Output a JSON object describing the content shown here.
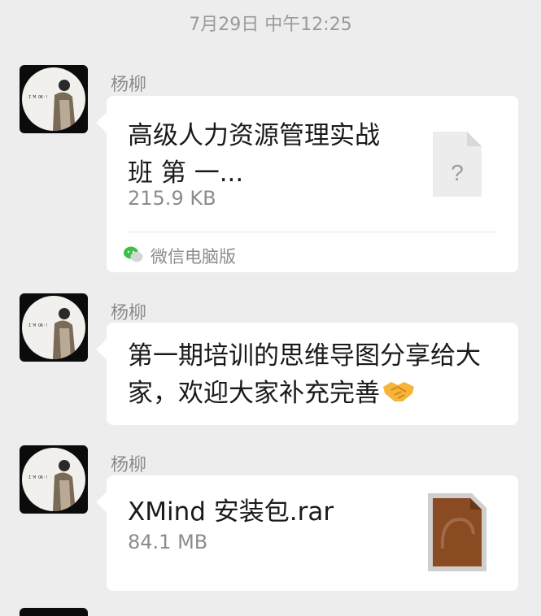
{
  "timestamp": "7月29日 中午12:25",
  "messages": [
    {
      "sender": "杨柳",
      "file_title": "高级人力资源管理实战班 第 一...",
      "file_size": "215.9 KB",
      "source": "微信电脑版",
      "icon": "unknown-file-icon"
    },
    {
      "sender": "杨柳",
      "text": "第一期培训的思维导图分享给大家，欢迎大家补充完善",
      "emoji": "handshake-emoji"
    },
    {
      "sender": "杨柳",
      "file_title": "XMind 安装包.rar",
      "file_size": "84.1 MB",
      "icon": "rar-archive-icon"
    }
  ],
  "avatar": {
    "caption": "I'M OK·!"
  },
  "colors": {
    "background": "#ededed",
    "bubble": "#ffffff",
    "secondary_text": "#8c8c8c"
  }
}
